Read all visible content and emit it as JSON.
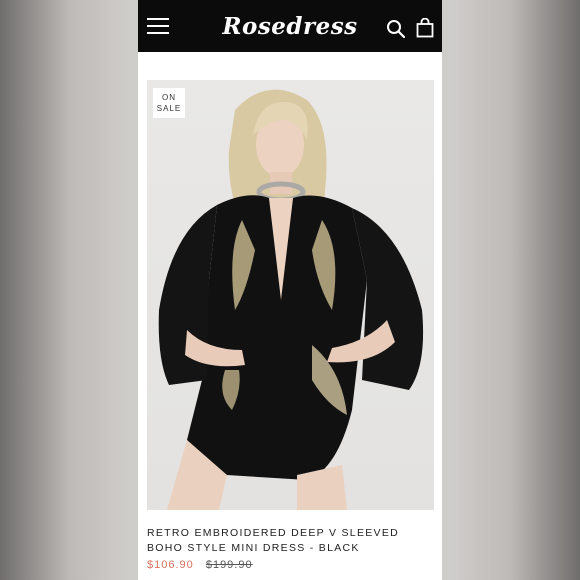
{
  "header": {
    "logo": "Rosedress",
    "menu_icon": "hamburger-menu-icon",
    "search_icon": "search-icon",
    "cart_icon": "shopping-bag-icon",
    "background_color": "#0b0b0b"
  },
  "product": {
    "badge": "ON SALE",
    "title": "RETRO EMBROIDERED DEEP V SLEEVED BOHO STYLE MINI DRESS - BLACK",
    "sale_price": "$106.90",
    "original_price": "$199.90",
    "sale_price_color": "#d9725e"
  }
}
